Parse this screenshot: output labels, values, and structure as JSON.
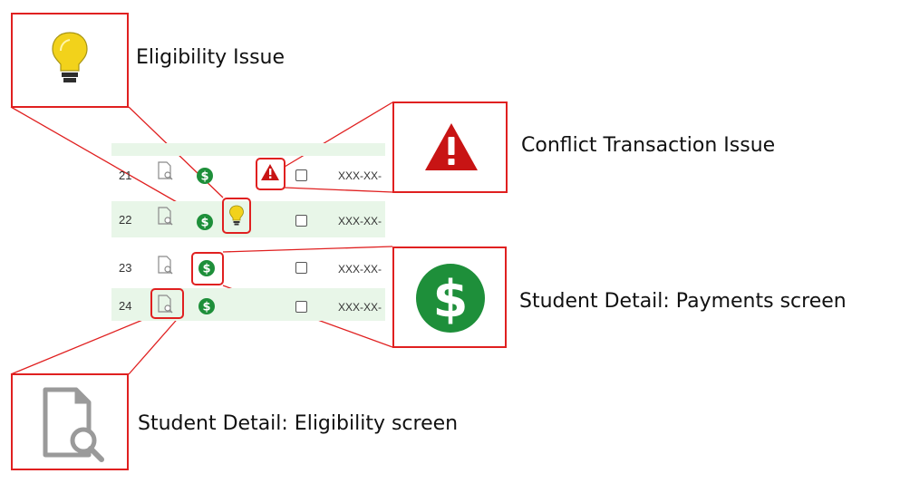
{
  "callouts": {
    "eligibility_issue": {
      "label": "Eligibility Issue",
      "icon": "lightbulb-icon"
    },
    "conflict_transaction_issue": {
      "label": "Conflict Transaction Issue",
      "icon": "warning-triangle-icon"
    },
    "payments_screen": {
      "label": "Student Detail: Payments screen",
      "icon": "dollar-circle-icon"
    },
    "eligibility_screen": {
      "label": "Student Detail: Eligibility screen",
      "icon": "document-search-icon"
    }
  },
  "table": {
    "rows": [
      {
        "num": "21",
        "ssn": "XXX-XX-",
        "has_warning": true,
        "has_bulb": false
      },
      {
        "num": "22",
        "ssn": "XXX-XX-",
        "has_warning": false,
        "has_bulb": true
      },
      {
        "num": "23",
        "ssn": "XXX-XX-",
        "has_warning": false,
        "has_bulb": false
      },
      {
        "num": "24",
        "ssn": "XXX-XX-",
        "has_warning": false,
        "has_bulb": false
      }
    ]
  },
  "colors": {
    "highlight_red": "#e02020",
    "row_green": "#e8f6e8",
    "dollar_green": "#1e8f3a",
    "warning_red": "#c81414",
    "bulb_yellow": "#f2d21b"
  }
}
